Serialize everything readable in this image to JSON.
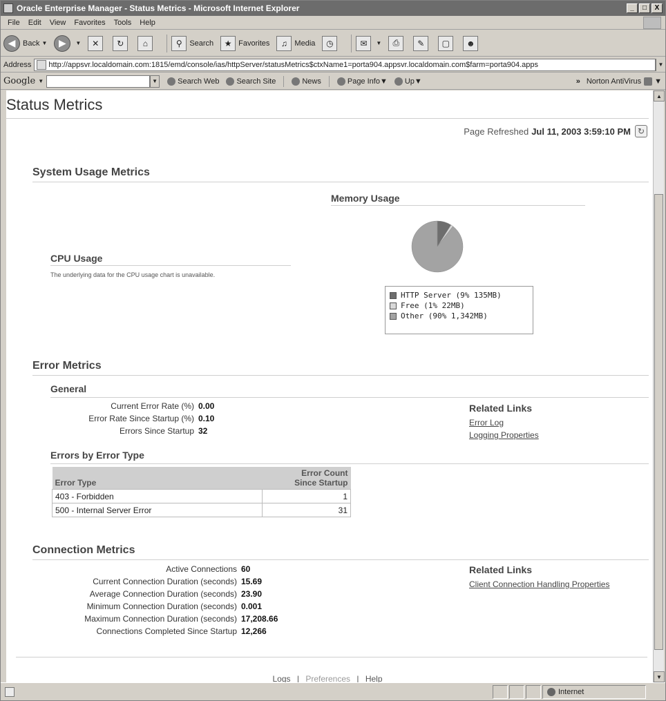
{
  "window": {
    "title": "Oracle Enterprise Manager - Status Metrics - Microsoft Internet Explorer",
    "buttons": [
      "_",
      "□",
      "X"
    ]
  },
  "menubar": [
    "File",
    "Edit",
    "View",
    "Favorites",
    "Tools",
    "Help"
  ],
  "toolbar": {
    "back": "Back",
    "search": "Search",
    "favorites": "Favorites",
    "media": "Media"
  },
  "address": {
    "label": "Address",
    "url": "http://appsvr.localdomain.com:1815/emd/console/ias/httpServer/statusMetrics$ctxName1=porta904.appsvr.localdomain.com$farm=porta904.apps"
  },
  "googlebar": {
    "logo": "Google",
    "search_web": "Search Web",
    "search_site": "Search Site",
    "news": "News",
    "page_info": "Page Info",
    "up": "Up",
    "norton": "Norton AntiVirus"
  },
  "page": {
    "title": "Status Metrics",
    "refreshed_label": "Page Refreshed",
    "refreshed_value": "Jul 11, 2003 3:59:10 PM"
  },
  "system_usage": {
    "heading": "System Usage Metrics",
    "cpu_heading": "CPU Usage",
    "cpu_note": "The underlying data for the CPU usage chart is unavailable.",
    "memory_heading": "Memory Usage",
    "legend": [
      {
        "label": "HTTP Server (9% 135MB)",
        "color": "#6e6e6e"
      },
      {
        "label": "Free (1% 22MB)",
        "color": "#d8d8d8"
      },
      {
        "label": "Other (90% 1,342MB)",
        "color": "#a3a3a3"
      }
    ]
  },
  "chart_data": {
    "type": "pie",
    "title": "Memory Usage",
    "categories": [
      "HTTP Server",
      "Free",
      "Other"
    ],
    "values": [
      135,
      22,
      1342
    ],
    "percent": [
      9,
      1,
      90
    ],
    "unit": "MB"
  },
  "error_metrics": {
    "heading": "Error Metrics",
    "general_heading": "General",
    "rows": [
      {
        "label": "Current Error Rate (%)",
        "value": "0.00"
      },
      {
        "label": "Error Rate Since Startup (%)",
        "value": "0.10"
      },
      {
        "label": "Errors Since Startup",
        "value": "32"
      }
    ],
    "related_heading": "Related Links",
    "links": [
      "Error Log",
      "Logging Properties"
    ],
    "by_type_heading": "Errors by Error Type",
    "table": {
      "col_type": "Error Type",
      "col_count_1": "Error Count",
      "col_count_2": "Since Startup",
      "rows": [
        {
          "type": "403 - Forbidden",
          "count": "1"
        },
        {
          "type": "500 - Internal Server Error",
          "count": "31"
        }
      ]
    }
  },
  "connection_metrics": {
    "heading": "Connection Metrics",
    "rows": [
      {
        "label": "Active Connections",
        "value": "60"
      },
      {
        "label": "Current Connection Duration (seconds)",
        "value": "15.69"
      },
      {
        "label": "Average Connection Duration (seconds)",
        "value": "23.90"
      },
      {
        "label": "Minimum Connection Duration (seconds)",
        "value": "0.001"
      },
      {
        "label": "Maximum Connection Duration (seconds)",
        "value": "17,208.66"
      },
      {
        "label": "Connections Completed Since Startup",
        "value": "12,266"
      }
    ],
    "related_heading": "Related Links",
    "link": "Client Connection Handling Properties"
  },
  "footer": {
    "logs": "Logs",
    "preferences": "Preferences",
    "help": "Help",
    "separator": "|"
  },
  "statusbar": {
    "zone": "Internet"
  }
}
